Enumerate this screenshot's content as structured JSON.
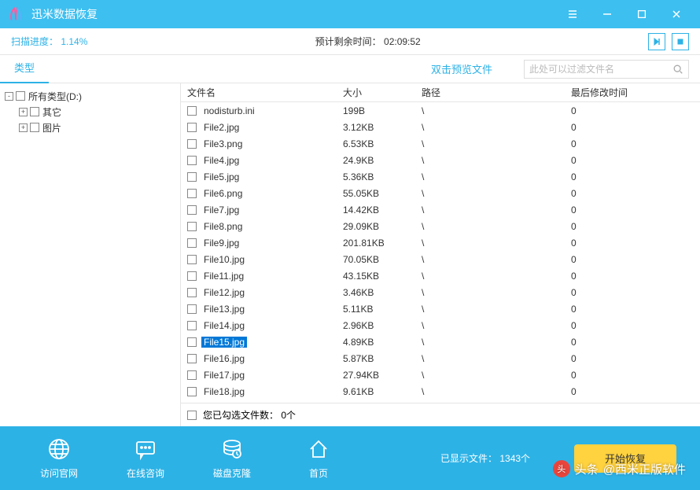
{
  "title": "迅米数据恢复",
  "progress": {
    "label": "扫描进度：",
    "value": "1.14%",
    "remaining_label": "预计剩余时间：",
    "remaining_value": "02:09:52"
  },
  "tab": "类型",
  "preview_hint": "双击预览文件",
  "search_placeholder": "此处可以过滤文件名",
  "tree": {
    "root": "所有类型(D:)",
    "children": [
      "其它",
      "图片"
    ]
  },
  "columns": {
    "name": "文件名",
    "size": "大小",
    "path": "路径",
    "time": "最后修改时间"
  },
  "files": [
    {
      "name": "nodisturb.ini",
      "size": "199B",
      "path": "\\",
      "time": "0"
    },
    {
      "name": "File2.jpg",
      "size": "3.12KB",
      "path": "\\",
      "time": "0"
    },
    {
      "name": "File3.png",
      "size": "6.53KB",
      "path": "\\",
      "time": "0"
    },
    {
      "name": "File4.jpg",
      "size": "24.9KB",
      "path": "\\",
      "time": "0"
    },
    {
      "name": "File5.jpg",
      "size": "5.36KB",
      "path": "\\",
      "time": "0"
    },
    {
      "name": "File6.png",
      "size": "55.05KB",
      "path": "\\",
      "time": "0"
    },
    {
      "name": "File7.jpg",
      "size": "14.42KB",
      "path": "\\",
      "time": "0"
    },
    {
      "name": "File8.png",
      "size": "29.09KB",
      "path": "\\",
      "time": "0"
    },
    {
      "name": "File9.jpg",
      "size": "201.81KB",
      "path": "\\",
      "time": "0"
    },
    {
      "name": "File10.jpg",
      "size": "70.05KB",
      "path": "\\",
      "time": "0"
    },
    {
      "name": "File11.jpg",
      "size": "43.15KB",
      "path": "\\",
      "time": "0"
    },
    {
      "name": "File12.jpg",
      "size": "3.46KB",
      "path": "\\",
      "time": "0"
    },
    {
      "name": "File13.jpg",
      "size": "5.11KB",
      "path": "\\",
      "time": "0"
    },
    {
      "name": "File14.jpg",
      "size": "2.96KB",
      "path": "\\",
      "time": "0"
    },
    {
      "name": "File15.jpg",
      "size": "4.89KB",
      "path": "\\",
      "time": "0",
      "selected": true
    },
    {
      "name": "File16.jpg",
      "size": "5.87KB",
      "path": "\\",
      "time": "0"
    },
    {
      "name": "File17.jpg",
      "size": "27.94KB",
      "path": "\\",
      "time": "0"
    },
    {
      "name": "File18.jpg",
      "size": "9.61KB",
      "path": "\\",
      "time": "0"
    }
  ],
  "selected_count": {
    "label": "您已勾选文件数：",
    "value": "0个"
  },
  "bottom": {
    "b1": "访问官网",
    "b2": "在线咨询",
    "b3": "磁盘克隆",
    "b4": "首页",
    "info_label": "已显示文件：",
    "info_value": "1343个",
    "recover": "开始恢复"
  },
  "watermark": {
    "prefix": "头条",
    "author": "@西米正版软件"
  }
}
